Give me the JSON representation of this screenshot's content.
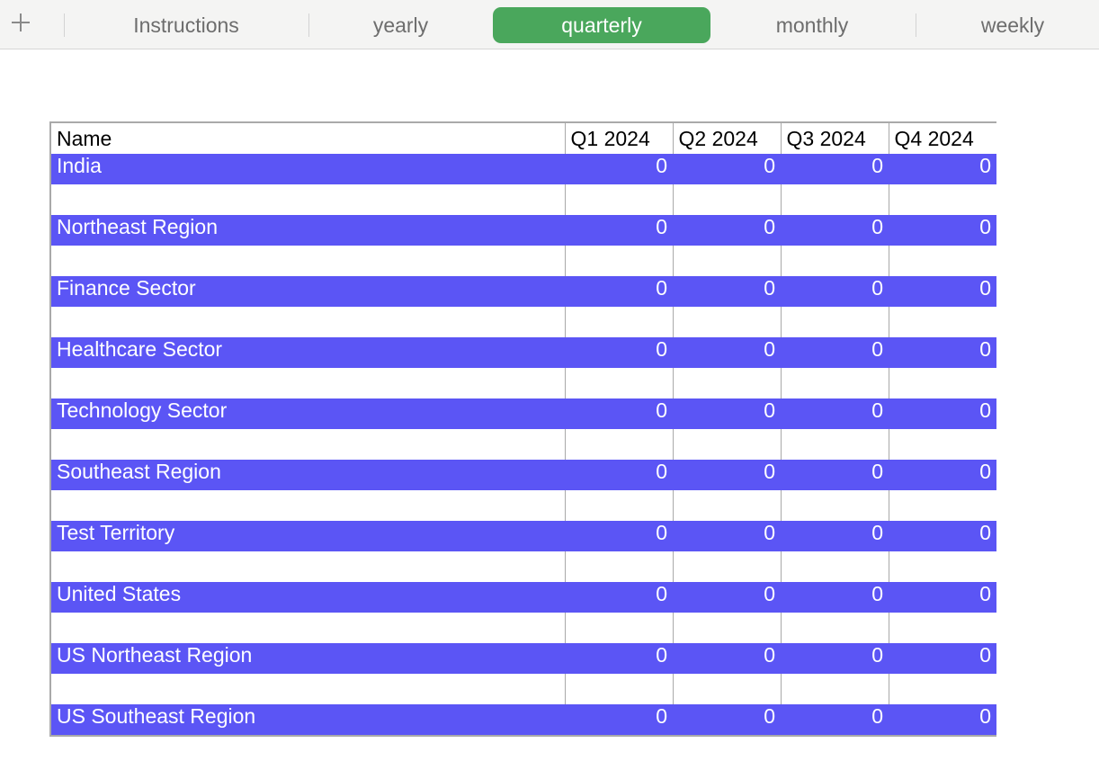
{
  "tabbar": {
    "add_icon": "plus-icon",
    "tabs": [
      {
        "label": "Instructions",
        "active": false
      },
      {
        "label": "yearly",
        "active": false
      },
      {
        "label": "quarterly",
        "active": true
      },
      {
        "label": "monthly",
        "active": false
      },
      {
        "label": "weekly",
        "active": false
      }
    ],
    "active_color": "#4aa75c"
  },
  "table": {
    "columns": [
      "Name",
      "Q1 2024",
      "Q2 2024",
      "Q3 2024",
      "Q4 2024"
    ],
    "row_color": "#5b55f5",
    "rows": [
      {
        "name": "India",
        "values": [
          "0",
          "0",
          "0",
          "0"
        ]
      },
      {
        "name": "Northeast Region",
        "values": [
          "0",
          "0",
          "0",
          "0"
        ]
      },
      {
        "name": "Finance Sector",
        "values": [
          "0",
          "0",
          "0",
          "0"
        ]
      },
      {
        "name": "Healthcare Sector",
        "values": [
          "0",
          "0",
          "0",
          "0"
        ]
      },
      {
        "name": "Technology Sector",
        "values": [
          "0",
          "0",
          "0",
          "0"
        ]
      },
      {
        "name": "Southeast Region",
        "values": [
          "0",
          "0",
          "0",
          "0"
        ]
      },
      {
        "name": "Test Territory",
        "values": [
          "0",
          "0",
          "0",
          "0"
        ]
      },
      {
        "name": "United States",
        "values": [
          "0",
          "0",
          "0",
          "0"
        ]
      },
      {
        "name": "US Northeast Region",
        "values": [
          "0",
          "0",
          "0",
          "0"
        ]
      },
      {
        "name": "US Southeast Region",
        "values": [
          "0",
          "0",
          "0",
          "0"
        ]
      }
    ]
  }
}
